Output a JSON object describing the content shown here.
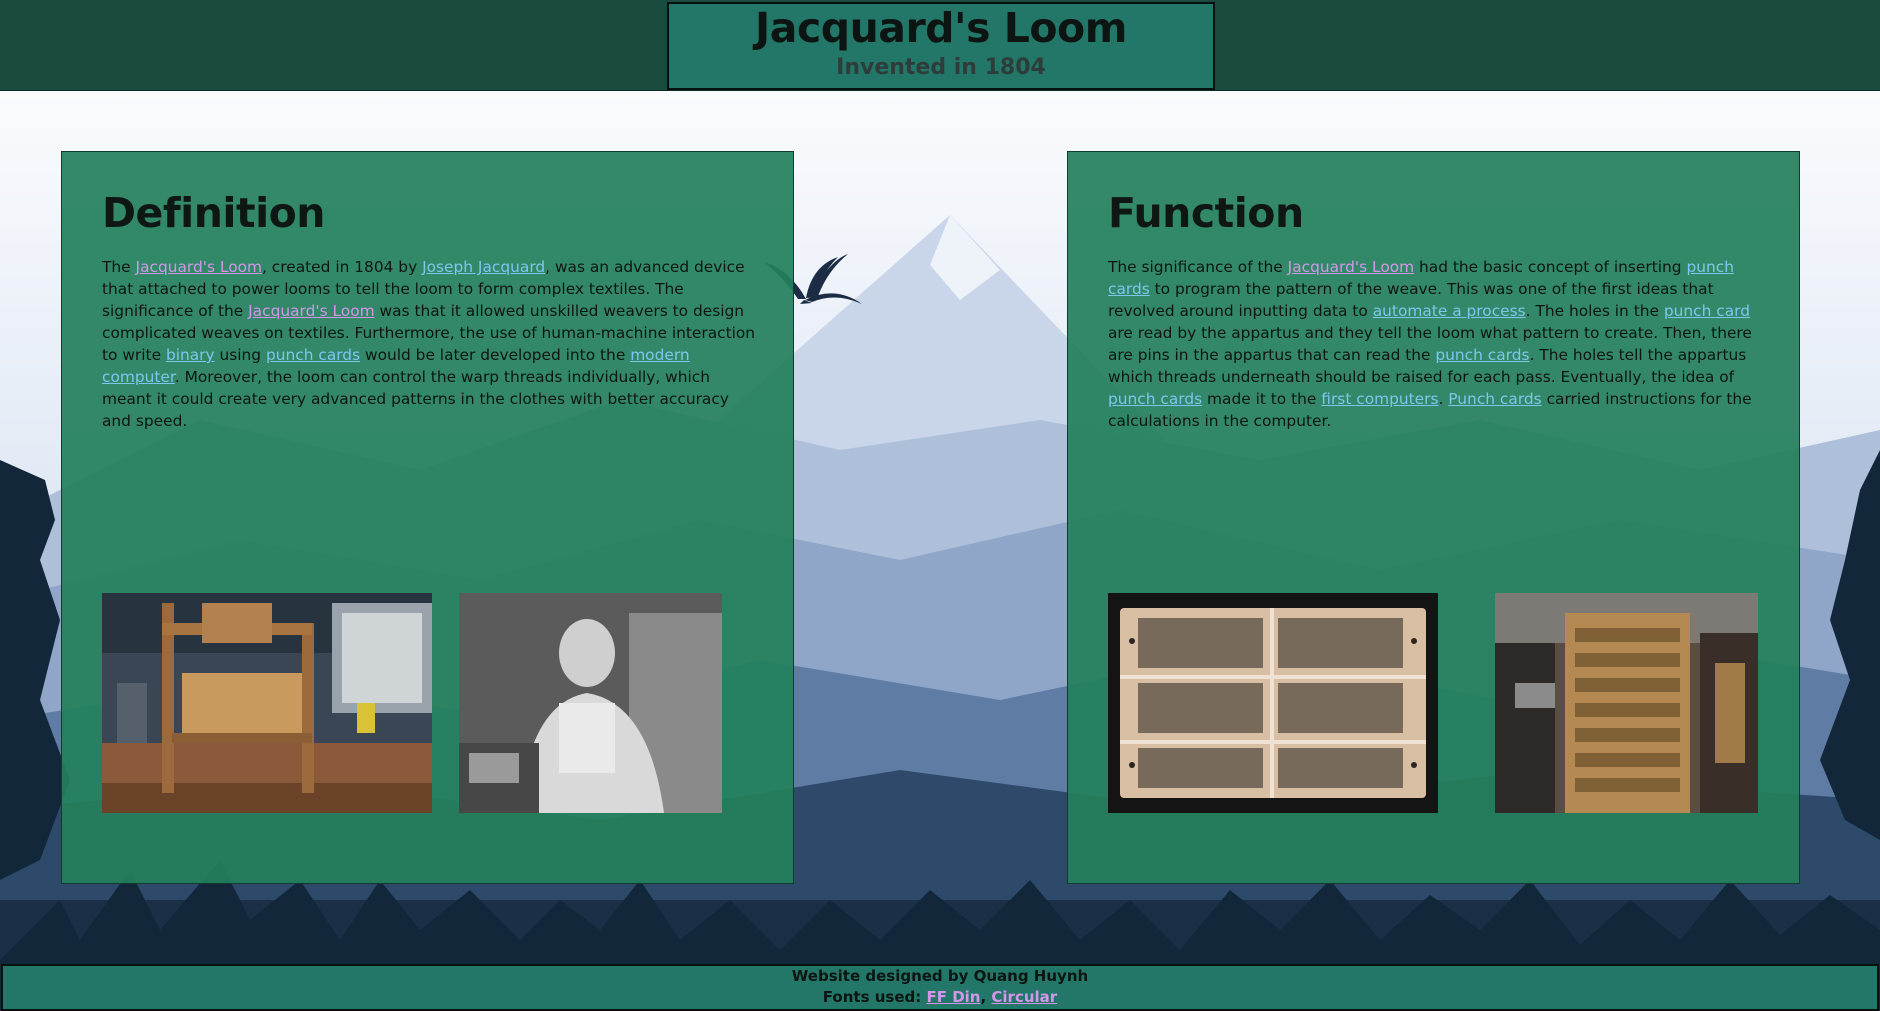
{
  "header": {
    "title": "Jacquard's Loom",
    "subtitle": "Invented in 1804"
  },
  "definition": {
    "heading": "Definition",
    "text": {
      "t1": "The ",
      "link_loom": "Jacquard's Loom",
      "t2": ", created in 1804 by ",
      "link_person": "Joseph Jacquard",
      "t3": ", was an advanced device that attached to power looms to tell the loom to form complex textiles. The significance of the ",
      "link_loom2": "Jacquard's Loom",
      "t4": " was that it allowed unskilled weavers to design complicated weaves on textiles. Furthermore, the use of human-machine interaction to write ",
      "link_binary": "binary",
      "t5": " using ",
      "link_punch": "punch cards",
      "t6": " would be later developed into the ",
      "link_computer": "modern computer",
      "t7": ". Moreover, the loom can control the warp threads individually, which meant it could create very advanced patterns in the clothes with better accuracy and speed."
    }
  },
  "function": {
    "heading": "Function",
    "text": {
      "t1": "The significance of the ",
      "link_loom": "Jacquard's Loom",
      "t2": " had the basic concept of inserting ",
      "link_punch1": "punch cards",
      "t3": " to program the pattern of the weave. This was one of the first ideas that revolved around inputting data to ",
      "link_automate": "automate a process",
      "t4": ". The holes in the ",
      "link_punch2": "punch card",
      "t5": " are read by the appartus and they tell the loom what pattern to create. Then, there are pins in the appartus that can read the ",
      "link_punch3": "punch cards",
      "t6": ". The holes tell the appartus which threads underneath should be raised for each pass. Eventually, the idea of ",
      "link_punch4": "punch cards",
      "t7": " made it to the ",
      "link_first": "first computers",
      "t8": ". ",
      "link_punch5": "Punch cards",
      "t9": " carried instructions for the calculations in the computer."
    }
  },
  "footer": {
    "credit": "Website designed by Quang Huynh",
    "fonts_label": "Fonts used: ",
    "font1": "FF Din",
    "sep": ", ",
    "font2": "Circular"
  },
  "colors": {
    "header_bg": "#1a4b3f",
    "title_box_bg": "#237769",
    "panel_bg": "#24805c",
    "link_purple": "#d596ea",
    "link_blue": "#7dc7ee"
  },
  "icons": [
    "bird-icon"
  ]
}
